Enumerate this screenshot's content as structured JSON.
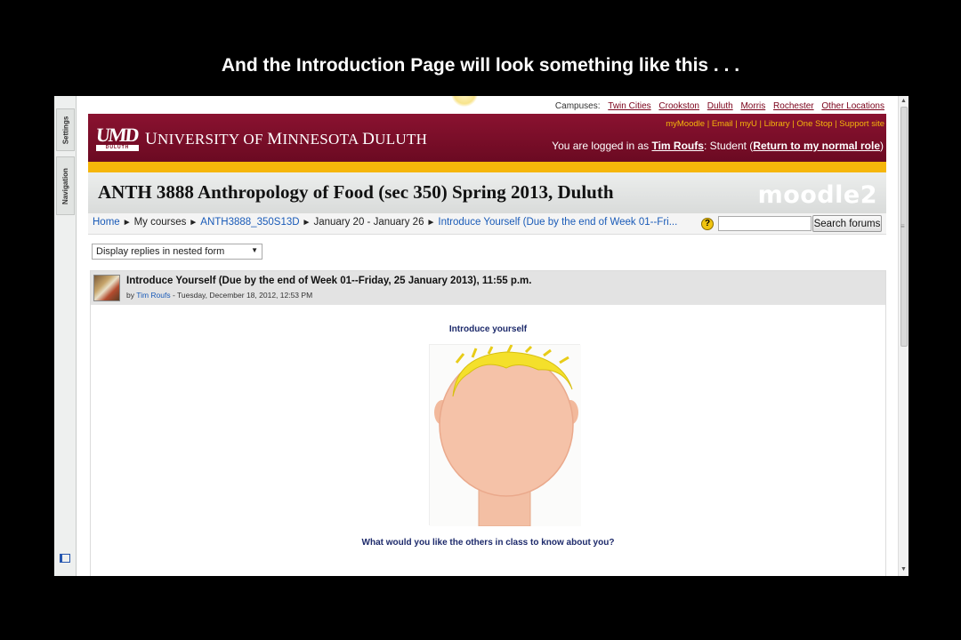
{
  "slide": {
    "title": "And the  Introduction Page will look something like this . . ."
  },
  "dock": {
    "settings_label": "Settings",
    "navigation_label": "Navigation",
    "dock_icon": "dock-panel-icon"
  },
  "campus_bar": {
    "label": "Campuses:",
    "links": [
      "Twin Cities",
      "Crookston",
      "Duluth",
      "Morris",
      "Rochester",
      "Other Locations"
    ]
  },
  "header": {
    "logo_text": "UMD",
    "logo_subtext": "DULUTH",
    "university_name_1": "U",
    "university_name_2": "NIVERSITY OF ",
    "university_name_3": "M",
    "university_name_4": "INNESOTA ",
    "university_name_5": "D",
    "university_name_6": "ULUTH",
    "top_links": [
      "myMoodle",
      "Email",
      "myU",
      "Library",
      "One Stop",
      "Support site"
    ],
    "logged_in_prefix": "You are logged in as ",
    "user_name": "Tim Roufs",
    "logged_in_middle": ": Student (",
    "return_role": "Return to my normal role",
    "logged_in_suffix": ")",
    "brand_color": "#7a0019",
    "gold_color": "#f5b60a"
  },
  "course": {
    "title": "ANTH 3888 Anthropology of Food (sec 350) Spring 2013, Duluth",
    "moodle_logo": "moodle2"
  },
  "breadcrumb": {
    "home": "Home",
    "my_courses": "My courses",
    "course_code": "ANTH3888_350S13D",
    "week": "January 20 - January 26",
    "current": "Introduce Yourself (Due by the end of Week 01--Fri..."
  },
  "search": {
    "button_label": "Search forums",
    "value": "",
    "help_icon": "help-icon"
  },
  "display_mode": {
    "selected": "Display replies in nested form"
  },
  "post": {
    "subject": "Introduce Yourself (Due by the end of Week 01--Friday, 25 January 2013), 11:55 p.m.",
    "by_prefix": "by ",
    "author": "Tim Roufs",
    "date": " - Tuesday, December 18, 2012, 12:53 PM",
    "intro_heading": "Introduce yourself",
    "question": "What would you like the others in class to know about you?"
  }
}
